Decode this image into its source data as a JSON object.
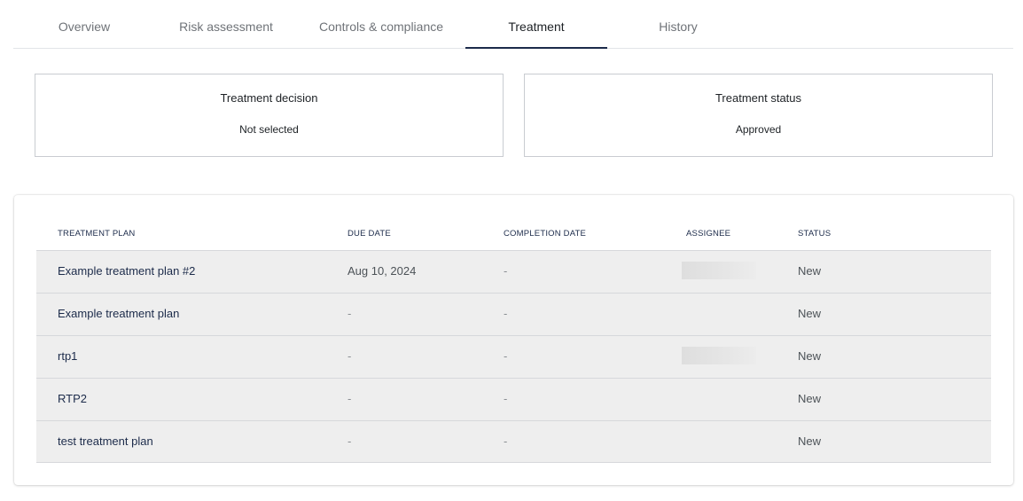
{
  "tabs": [
    {
      "label": "Overview",
      "active": false
    },
    {
      "label": "Risk assessment",
      "active": false
    },
    {
      "label": "Controls & compliance",
      "active": false
    },
    {
      "label": "Treatment",
      "active": true
    },
    {
      "label": "History",
      "active": false
    }
  ],
  "summary": {
    "decision": {
      "title": "Treatment decision",
      "value": "Not selected"
    },
    "status": {
      "title": "Treatment status",
      "value": "Approved"
    }
  },
  "table": {
    "columns": [
      "TREATMENT PLAN",
      "DUE DATE",
      "COMPLETION DATE",
      "ASSIGNEE",
      "STATUS"
    ],
    "rows": [
      {
        "plan": "Example treatment plan #2",
        "due": "Aug 10, 2024",
        "completion": "-",
        "assignee_redacted": true,
        "status": "New"
      },
      {
        "plan": "Example treatment plan",
        "due": "-",
        "completion": "-",
        "assignee_redacted": false,
        "status": "New"
      },
      {
        "plan": "rtp1",
        "due": "-",
        "completion": "-",
        "assignee_redacted": true,
        "status": "New"
      },
      {
        "plan": "RTP2",
        "due": "-",
        "completion": "-",
        "assignee_redacted": false,
        "status": "New"
      },
      {
        "plan": "test treatment plan",
        "due": "-",
        "completion": "-",
        "assignee_redacted": false,
        "status": "New"
      }
    ]
  },
  "colors": {
    "accent": "#1c2b4a",
    "row_background": "#eeeeee",
    "border": "#c9ccd1"
  }
}
